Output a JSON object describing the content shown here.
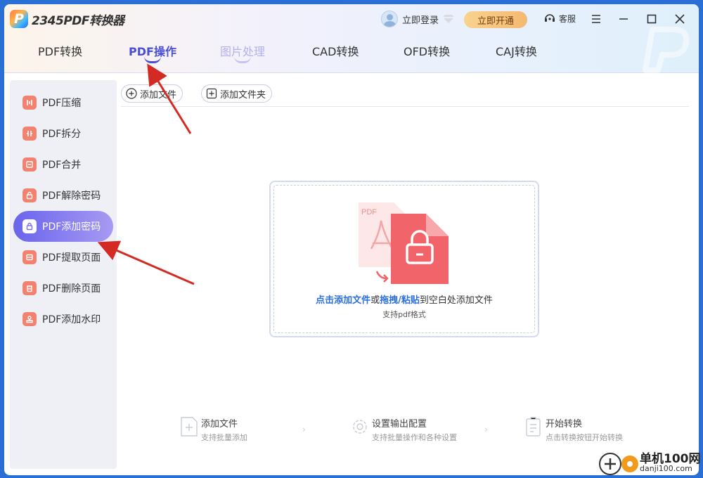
{
  "app": {
    "logo_letter": "P",
    "name": "2345PDF转换器"
  },
  "header": {
    "login_label": "立即登录",
    "vip_label": "立即开通",
    "service_label": "客服"
  },
  "tabs": [
    {
      "label": "PDF转换"
    },
    {
      "label": "PDF操作"
    },
    {
      "label": "图片处理"
    },
    {
      "label": "CAD转换"
    },
    {
      "label": "OFD转换"
    },
    {
      "label": "CAJ转换"
    }
  ],
  "active_tab": "PDF操作",
  "sidebar": {
    "items": [
      {
        "label": "PDF压缩"
      },
      {
        "label": "PDF拆分"
      },
      {
        "label": "PDF合并"
      },
      {
        "label": "PDF解除密码"
      },
      {
        "label": "PDF添加密码"
      },
      {
        "label": "PDF提取页面"
      },
      {
        "label": "PDF删除页面"
      },
      {
        "label": "PDF添加水印"
      }
    ],
    "active": "PDF添加密码"
  },
  "toolbar": {
    "add_file": "添加文件",
    "add_folder": "添加文件夹"
  },
  "dropzone": {
    "file_tag": "PDF",
    "text_click": "点击添加文件",
    "text_or": "或",
    "text_drag": "拖拽/粘贴",
    "text_rest": "到空白处添加文件",
    "sub": "支持pdf格式"
  },
  "steps": [
    {
      "title": "添加文件",
      "desc": "支持批量添加"
    },
    {
      "title": "设置输出配置",
      "desc": "支持批量操作和各种设置"
    },
    {
      "title": "开始转换",
      "desc": "点击转换按钮开始转换"
    }
  ],
  "watermark": {
    "name": "单机100网",
    "url": "danji100.com"
  },
  "colors": {
    "accent": "#4a4fd8",
    "link": "#2b6fd8",
    "vip": "#f5b870",
    "icon": "#f2816f",
    "arrow": "#d42a24"
  }
}
